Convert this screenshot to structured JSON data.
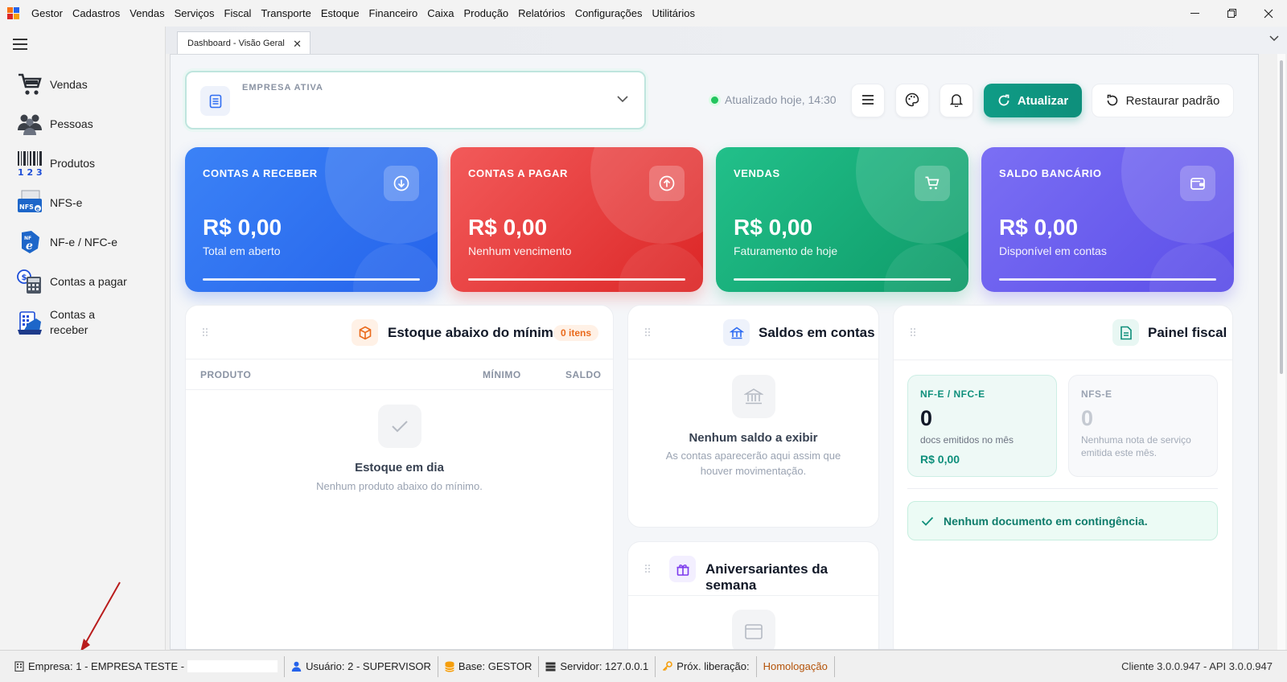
{
  "menubar": {
    "items": [
      "Gestor",
      "Cadastros",
      "Vendas",
      "Serviços",
      "Fiscal",
      "Transporte",
      "Estoque",
      "Financeiro",
      "Caixa",
      "Produção",
      "Relatórios",
      "Configurações",
      "Utilitários"
    ]
  },
  "sidebar": {
    "items": [
      {
        "label": "Vendas",
        "icon": "cart-icon"
      },
      {
        "label": "Pessoas",
        "icon": "people-icon"
      },
      {
        "label": "Produtos",
        "icon": "barcode-icon"
      },
      {
        "label": "NFS-e",
        "icon": "nfse-icon"
      },
      {
        "label": "NF-e / NFC-e",
        "icon": "nfe-icon"
      },
      {
        "label": "Contas a pagar",
        "icon": "calculator-icon"
      },
      {
        "label": "Contas a receber",
        "icon": "cash-register-icon"
      }
    ]
  },
  "tabs": [
    {
      "label": "Dashboard - Visão Geral"
    }
  ],
  "toolbar": {
    "empresa_label": "EMPRESA ATIVA",
    "status_text": "Atualizado hoje, 14:30",
    "atualizar_label": "Atualizar",
    "restaurar_label": "Restaurar padrão"
  },
  "kpis": [
    {
      "title": "CONTAS A RECEBER",
      "value": "R$ 0,00",
      "sub": "Total em aberto",
      "color": "#2f6df2"
    },
    {
      "title": "CONTAS A PAGAR",
      "value": "R$ 0,00",
      "sub": "Nenhum vencimento",
      "color": "#ee4747"
    },
    {
      "title": "VENDAS",
      "value": "R$ 0,00",
      "sub": "Faturamento de hoje",
      "color": "#15b27d"
    },
    {
      "title": "SALDO BANCÁRIO",
      "value": "R$ 0,00",
      "sub": "Disponível em contas",
      "color": "#6a5ef0"
    }
  ],
  "estoque": {
    "title": "Estoque abaixo do mínimo",
    "badge": "0 itens",
    "columns": [
      "PRODUTO",
      "MÍNIMO",
      "SALDO"
    ],
    "empty_title": "Estoque em dia",
    "empty_sub": "Nenhum produto abaixo do mínimo."
  },
  "saldos": {
    "title": "Saldos em contas",
    "empty_title": "Nenhum saldo a exibir",
    "empty_sub_1": "As contas aparecerão aqui assim que",
    "empty_sub_2": "houver movimentação."
  },
  "aniversariantes": {
    "title": "Aniversariantes da semana"
  },
  "fiscal": {
    "title": "Painel fiscal",
    "nfe": {
      "label": "NF-E / NFC-E",
      "count": "0",
      "sub": "docs emitidos no mês",
      "value": "R$ 0,00"
    },
    "nfse": {
      "label": "NFS-E",
      "count": "0",
      "sub": "Nenhuma nota de serviço emitida este mês."
    },
    "contingencia": "Nenhum documento em contingência."
  },
  "statusbar": {
    "empresa": "Empresa: 1 - EMPRESA TESTE -",
    "usuario": "Usuário: 2 - SUPERVISOR",
    "base": "Base: GESTOR",
    "servidor": "Servidor: 127.0.0.1",
    "prox": "Próx. liberação:",
    "homologacao": "Homologação",
    "versao": "Cliente 3.0.0.947 - API 3.0.0.947"
  },
  "colors": {
    "accent": "#0f9c86",
    "homologacao": "#b45309"
  }
}
